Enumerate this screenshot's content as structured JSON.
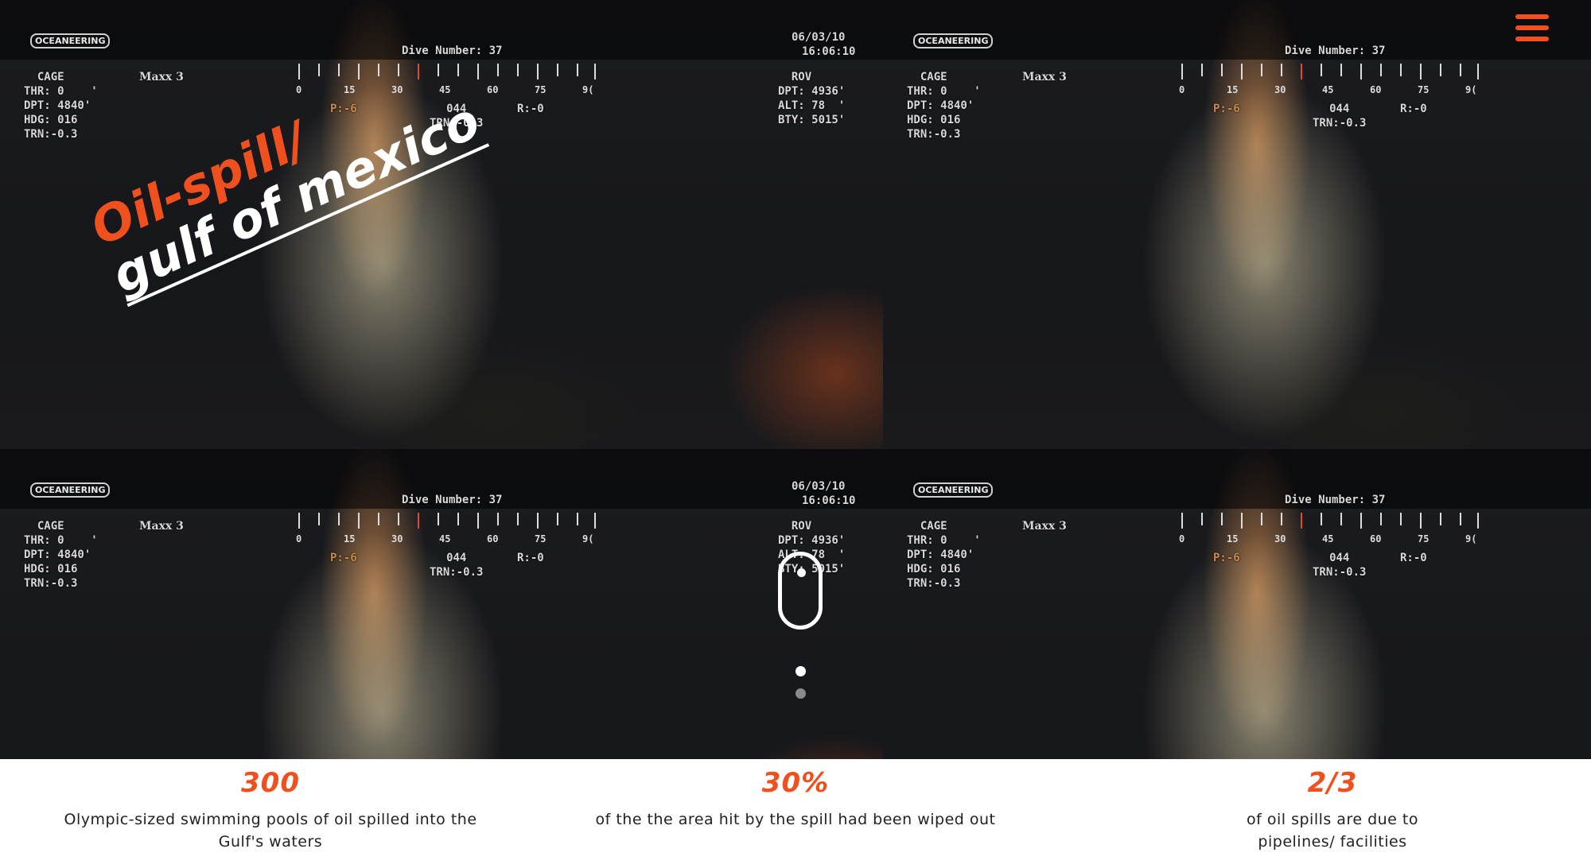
{
  "hero": {
    "title_line1": "Oil-spill/",
    "title_line2": "gulf of mexico",
    "osd": {
      "logo": "OCEANEERING",
      "date": "06/03/10",
      "time": "16:06:10",
      "dive": "Dive Number: 37",
      "left_block": "  CAGE\nTHR: 0    '\nDPT: 4840'\nHDG: 016\nTRN:-0.3",
      "maxx": "Maxx 3",
      "rov_block": "  ROV\nDPT: 4936'\nALT: 78  '\nBTY: 5015'",
      "mid_block": "044\nTRN:-0.3",
      "p_label": "P:-6",
      "r_label": "R:-0",
      "scale_numbers": [
        "0",
        "15",
        "30",
        "45",
        "60",
        "75",
        "9("
      ]
    }
  },
  "menu": {
    "icon": "hamburger-menu-icon",
    "color": "#f0501e"
  },
  "scroll": {
    "icon": "mouse-scroll-icon",
    "dots": 2,
    "active_dot": 1
  },
  "stats": [
    {
      "number": "300",
      "description": "Olympic-sized swimming pools of oil spilled into the Gulf's waters"
    },
    {
      "number": "30%",
      "description": "of the the area hit by the spill had been wiped out"
    },
    {
      "number": "2/3",
      "description": "of oil spills are due to pipelines/ facilities"
    }
  ],
  "colors": {
    "accent": "#f0501e",
    "stats_bg": "#ffffff",
    "text": "#222222"
  }
}
